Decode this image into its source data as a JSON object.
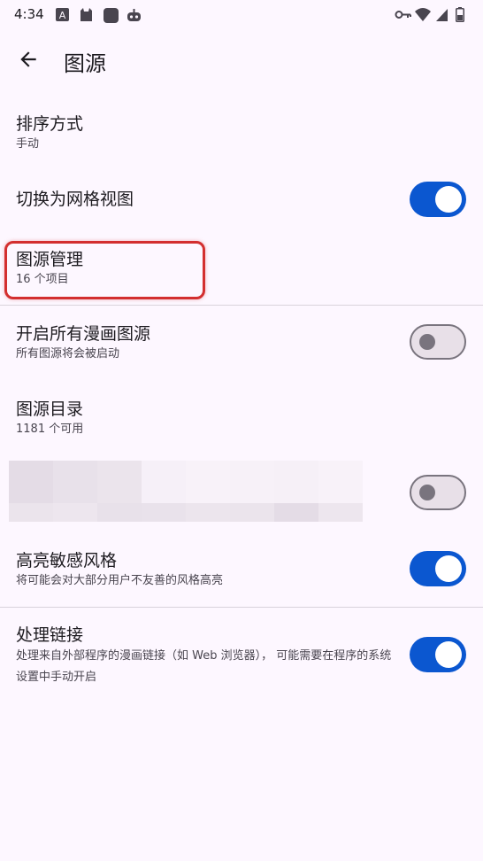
{
  "status_bar": {
    "time": "4:34",
    "icons_left": [
      "a-box-icon",
      "cat-icon",
      "square-app-icon",
      "robot-icon"
    ],
    "icons_right": [
      "key-icon",
      "wifi-icon",
      "signal-icon",
      "battery-icon"
    ]
  },
  "app_bar": {
    "title": "图源"
  },
  "items": {
    "sort": {
      "title": "排序方式",
      "subtitle": "手动"
    },
    "grid_view": {
      "title": "切换为网格视图",
      "enabled": true
    },
    "source_manage": {
      "title": "图源管理",
      "subtitle": "16 个项目"
    },
    "enable_all": {
      "title": "开启所有漫画图源",
      "subtitle": "所有图源将会被启动",
      "enabled": false
    },
    "catalog": {
      "title": "图源目录",
      "subtitle": "1181 个可用"
    },
    "hidden_item": {
      "enabled": false
    },
    "nsfw_highlight": {
      "title": "高亮敏感风格",
      "subtitle": "将可能会对大部分用户不友善的风格高亮",
      "enabled": true
    },
    "link_handling": {
      "title": "处理链接",
      "subtitle": "处理来自外部程序的漫画链接（如 Web 浏览器）， 可能需要在程序的系统设置中手动开启",
      "enabled": true
    }
  },
  "colors": {
    "background": "#fdf7ff",
    "switch_on": "#0b57d0",
    "switch_off_track": "#e8e0e8",
    "highlight_border": "#d32f2f"
  }
}
